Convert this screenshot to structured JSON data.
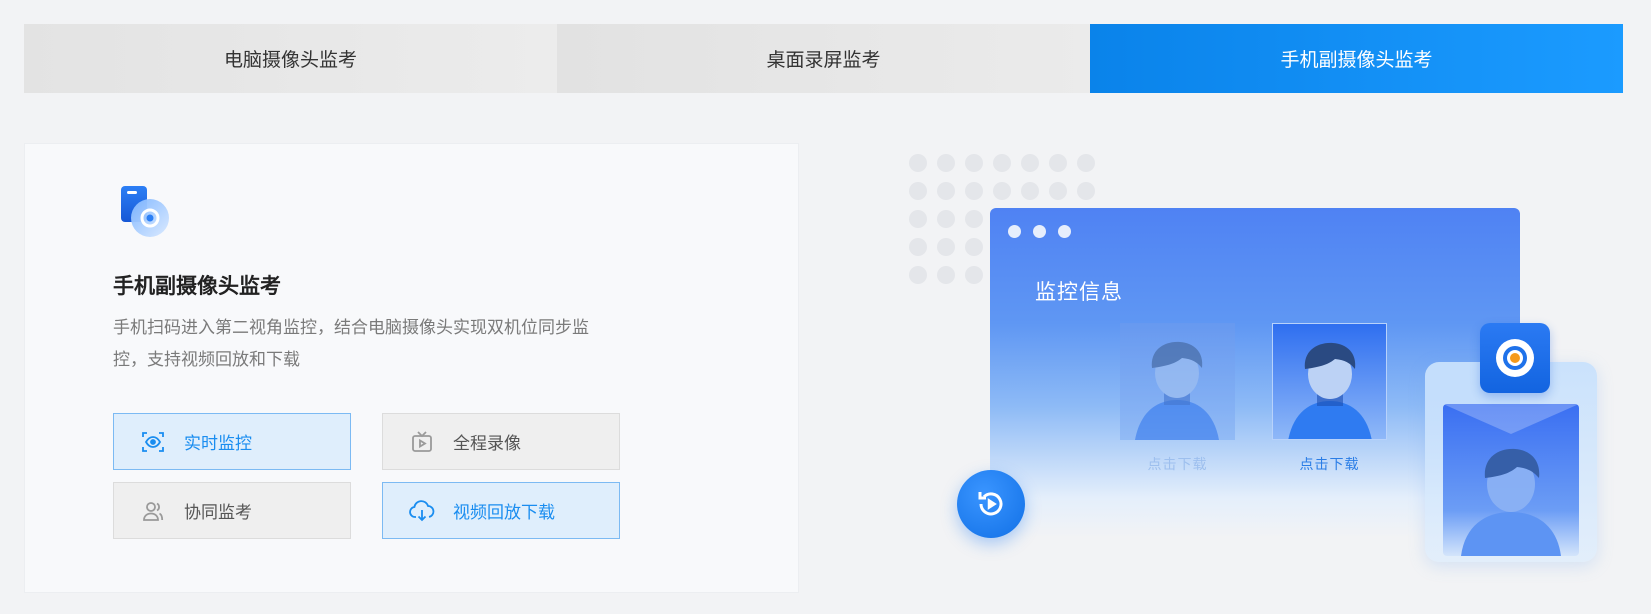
{
  "tabs": [
    {
      "label": "电脑摄像头监考"
    },
    {
      "label": "桌面录屏监考"
    },
    {
      "label": "手机副摄像头监考"
    }
  ],
  "card": {
    "icon": "phone-camera-icon",
    "title": "手机副摄像头监考",
    "description": "手机扫码进入第二视角监控，结合电脑摄像头实现双机位同步监控，支持视频回放和下载",
    "features": [
      {
        "label": "实时监控",
        "icon": "eye-scan-icon",
        "highlighted": true
      },
      {
        "label": "全程录像",
        "icon": "tv-play-icon",
        "highlighted": false
      },
      {
        "label": "协同监考",
        "icon": "users-icon",
        "highlighted": false
      },
      {
        "label": "视频回放下载",
        "icon": "cloud-download-icon",
        "highlighted": true
      }
    ]
  },
  "illustration": {
    "window_title": "监控信息",
    "download_labels": [
      "点击下载",
      "点击下载"
    ],
    "replay_icon": "replay-icon",
    "camera_icon": "camera-icon"
  },
  "colors": {
    "accent": "#1a8df0",
    "tab_active": "#0a83ea",
    "highlight_bg": "#dfeefc"
  }
}
